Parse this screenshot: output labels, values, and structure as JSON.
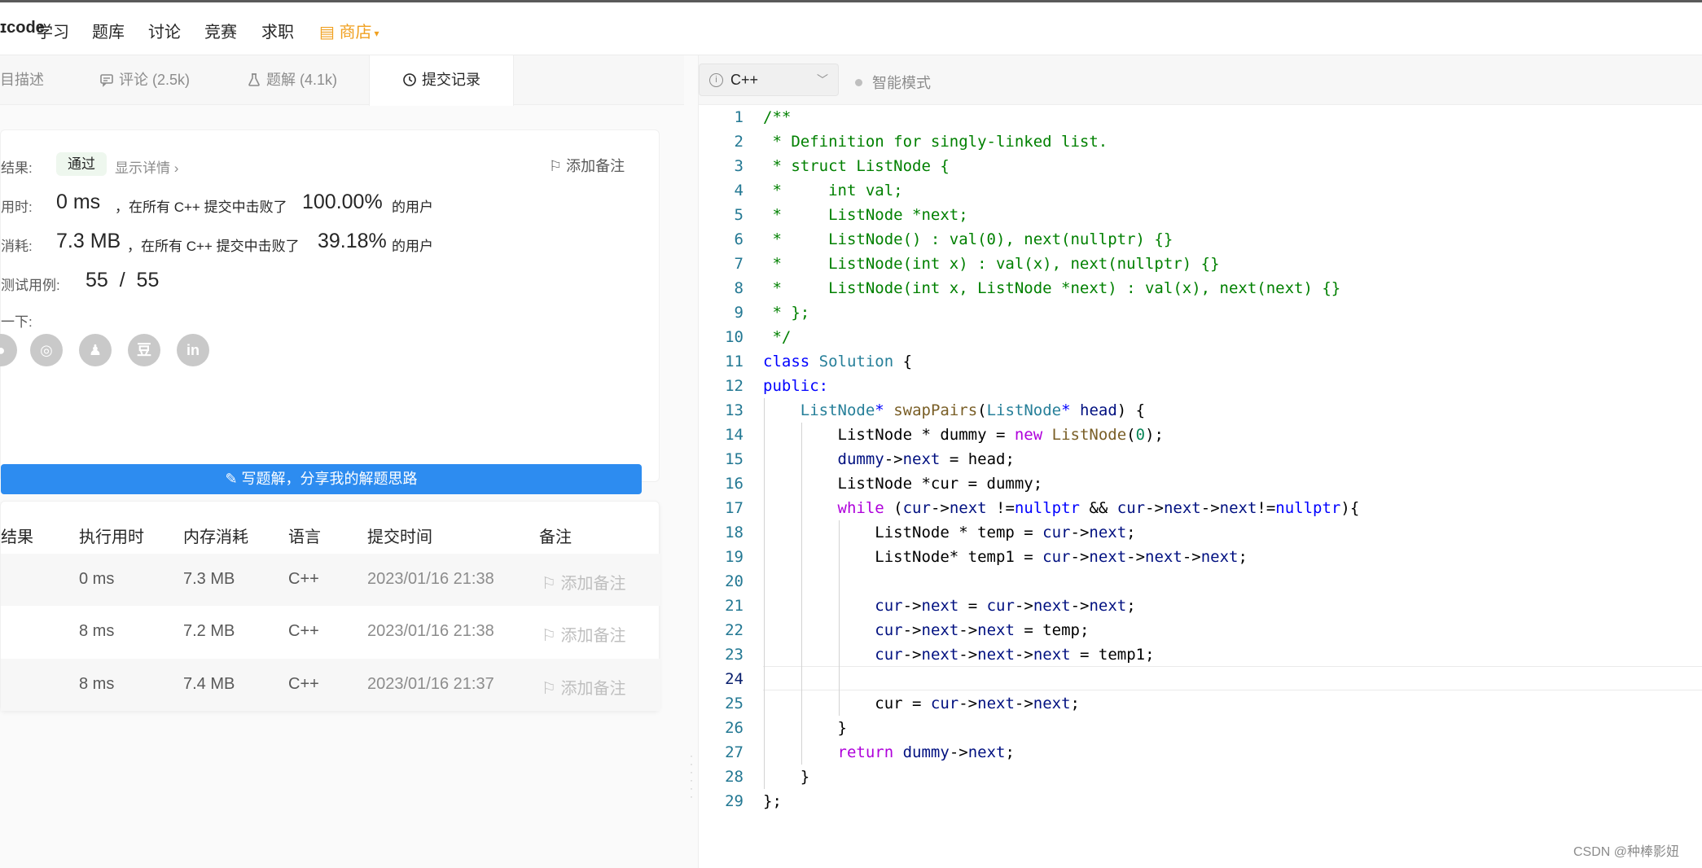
{
  "nav": {
    "logo": "ɪcode",
    "items": [
      "学习",
      "题库",
      "讨论",
      "竞赛",
      "求职"
    ],
    "shop": "商店"
  },
  "tabs": [
    {
      "label": "目描述"
    },
    {
      "label": "评论 (2.5k)"
    },
    {
      "label": "题解 (4.1k)"
    },
    {
      "label": "提交记录"
    }
  ],
  "result": {
    "result_label": "结果:",
    "status": "通过",
    "detail_link": "显示详情 ›",
    "add_note": "添加备注",
    "time_label": "用时:",
    "time_value": "0 ms",
    "time_text": "，在所有 C++ 提交中击败了",
    "time_percent": "100.00%",
    "time_suffix": "的用户",
    "mem_label": "消耗:",
    "mem_value": "7.3 MB",
    "mem_text": "，在所有 C++ 提交中击败了",
    "mem_percent": "39.18%",
    "mem_suffix": "的用户",
    "tests_label": "测试用例:",
    "tests_value": "55  /  55",
    "share_label": "一下:",
    "write_button": "写题解，分享我的解题思路"
  },
  "table": {
    "headers": [
      "结果",
      "执行用时",
      "内存消耗",
      "语言",
      "提交时间",
      "备注"
    ],
    "rows": [
      {
        "runtime": "0 ms",
        "memory": "7.3 MB",
        "lang": "C++",
        "time": "2023/01/16 21:38",
        "note": "添加备注"
      },
      {
        "runtime": "8 ms",
        "memory": "7.2 MB",
        "lang": "C++",
        "time": "2023/01/16 21:38",
        "note": "添加备注"
      },
      {
        "runtime": "8 ms",
        "memory": "7.4 MB",
        "lang": "C++",
        "time": "2023/01/16 21:37",
        "note": "添加备注"
      }
    ]
  },
  "editor": {
    "language": "C++",
    "mode": "智能模式",
    "current_line": 24,
    "lines": [
      [
        [
          "/**",
          "#008000"
        ]
      ],
      [
        [
          " * Definition for singly-linked list.",
          "#008000"
        ]
      ],
      [
        [
          " * struct ListNode {",
          "#008000"
        ]
      ],
      [
        [
          " *     int val;",
          "#008000"
        ]
      ],
      [
        [
          " *     ListNode *next;",
          "#008000"
        ]
      ],
      [
        [
          " *     ListNode() : val(0), next(nullptr) {}",
          "#008000"
        ]
      ],
      [
        [
          " *     ListNode(int x) : val(x), next(nullptr) {}",
          "#008000"
        ]
      ],
      [
        [
          " *     ListNode(int x, ListNode *next) : val(x), next(next) {}",
          "#008000"
        ]
      ],
      [
        [
          " * };",
          "#008000"
        ]
      ],
      [
        [
          " */",
          "#008000"
        ]
      ],
      [
        [
          "class",
          "#0000ff"
        ],
        [
          " ",
          "#000000"
        ],
        [
          "Solution",
          "#267f99"
        ],
        [
          " {",
          "#000000"
        ]
      ],
      [
        [
          "public:",
          "#0000ff"
        ]
      ],
      [
        [
          "    ",
          "#000000"
        ],
        [
          "ListNode",
          "#267f99"
        ],
        [
          "*",
          "#0000ff"
        ],
        [
          " ",
          "#000000"
        ],
        [
          "swapPairs",
          "#795e26"
        ],
        [
          "(",
          "#000000"
        ],
        [
          "ListNode",
          "#267f99"
        ],
        [
          "*",
          "#0000ff"
        ],
        [
          " ",
          "#000000"
        ],
        [
          "head",
          "#001080"
        ],
        [
          ") {",
          "#000000"
        ]
      ],
      [
        [
          "        ListNode * dummy = ",
          "#000000"
        ],
        [
          "new",
          "#af00db"
        ],
        [
          " ",
          "#000000"
        ],
        [
          "ListNode",
          "#795e26"
        ],
        [
          "(",
          "#000000"
        ],
        [
          "0",
          "#098658"
        ],
        [
          ");",
          "#000000"
        ]
      ],
      [
        [
          "        ",
          "#000000"
        ],
        [
          "dummy",
          "#001080"
        ],
        [
          "->",
          "#000000"
        ],
        [
          "next",
          "#001080"
        ],
        [
          " = head;",
          "#000000"
        ]
      ],
      [
        [
          "        ListNode *cur = dummy;",
          "#000000"
        ]
      ],
      [
        [
          "        ",
          "#000000"
        ],
        [
          "while",
          "#af00db"
        ],
        [
          " (",
          "#000000"
        ],
        [
          "cur",
          "#001080"
        ],
        [
          "->",
          "#000000"
        ],
        [
          "next",
          "#001080"
        ],
        [
          " !=",
          "#000000"
        ],
        [
          "nullptr",
          "#0000ff"
        ],
        [
          " && ",
          "#000000"
        ],
        [
          "cur",
          "#001080"
        ],
        [
          "->",
          "#000000"
        ],
        [
          "next",
          "#001080"
        ],
        [
          "->",
          "#000000"
        ],
        [
          "next",
          "#001080"
        ],
        [
          "!=",
          "#000000"
        ],
        [
          "nullptr",
          "#0000ff"
        ],
        [
          "){",
          "#000000"
        ]
      ],
      [
        [
          "            ListNode * temp = ",
          "#000000"
        ],
        [
          "cur",
          "#001080"
        ],
        [
          "->",
          "#000000"
        ],
        [
          "next",
          "#001080"
        ],
        [
          ";",
          "#000000"
        ]
      ],
      [
        [
          "            ListNode* temp1 = ",
          "#000000"
        ],
        [
          "cur",
          "#001080"
        ],
        [
          "->",
          "#000000"
        ],
        [
          "next",
          "#001080"
        ],
        [
          "->",
          "#000000"
        ],
        [
          "next",
          "#001080"
        ],
        [
          "->",
          "#000000"
        ],
        [
          "next",
          "#001080"
        ],
        [
          ";",
          "#000000"
        ]
      ],
      [
        [
          "",
          "#000000"
        ]
      ],
      [
        [
          "            ",
          "#000000"
        ],
        [
          "cur",
          "#001080"
        ],
        [
          "->",
          "#000000"
        ],
        [
          "next",
          "#001080"
        ],
        [
          " = ",
          "#000000"
        ],
        [
          "cur",
          "#001080"
        ],
        [
          "->",
          "#000000"
        ],
        [
          "next",
          "#001080"
        ],
        [
          "->",
          "#000000"
        ],
        [
          "next",
          "#001080"
        ],
        [
          ";",
          "#000000"
        ]
      ],
      [
        [
          "            ",
          "#000000"
        ],
        [
          "cur",
          "#001080"
        ],
        [
          "->",
          "#000000"
        ],
        [
          "next",
          "#001080"
        ],
        [
          "->",
          "#000000"
        ],
        [
          "next",
          "#001080"
        ],
        [
          " = temp;",
          "#000000"
        ]
      ],
      [
        [
          "            ",
          "#000000"
        ],
        [
          "cur",
          "#001080"
        ],
        [
          "->",
          "#000000"
        ],
        [
          "next",
          "#001080"
        ],
        [
          "->",
          "#000000"
        ],
        [
          "next",
          "#001080"
        ],
        [
          "->",
          "#000000"
        ],
        [
          "next",
          "#001080"
        ],
        [
          " = temp1;",
          "#000000"
        ]
      ],
      [
        [
          "",
          "#000000"
        ]
      ],
      [
        [
          "            cur = ",
          "#000000"
        ],
        [
          "cur",
          "#001080"
        ],
        [
          "->",
          "#000000"
        ],
        [
          "next",
          "#001080"
        ],
        [
          "->",
          "#000000"
        ],
        [
          "next",
          "#001080"
        ],
        [
          ";",
          "#000000"
        ]
      ],
      [
        [
          "        }",
          "#000000"
        ]
      ],
      [
        [
          "        ",
          "#000000"
        ],
        [
          "return",
          "#af00db"
        ],
        [
          " ",
          "#000000"
        ],
        [
          "dummy",
          "#001080"
        ],
        [
          "->",
          "#000000"
        ],
        [
          "next",
          "#001080"
        ],
        [
          ";",
          "#000000"
        ]
      ],
      [
        [
          "    }",
          "#000000"
        ]
      ],
      [
        [
          "};",
          "#000000"
        ]
      ]
    ]
  },
  "watermark": "CSDN @种棒影妞"
}
